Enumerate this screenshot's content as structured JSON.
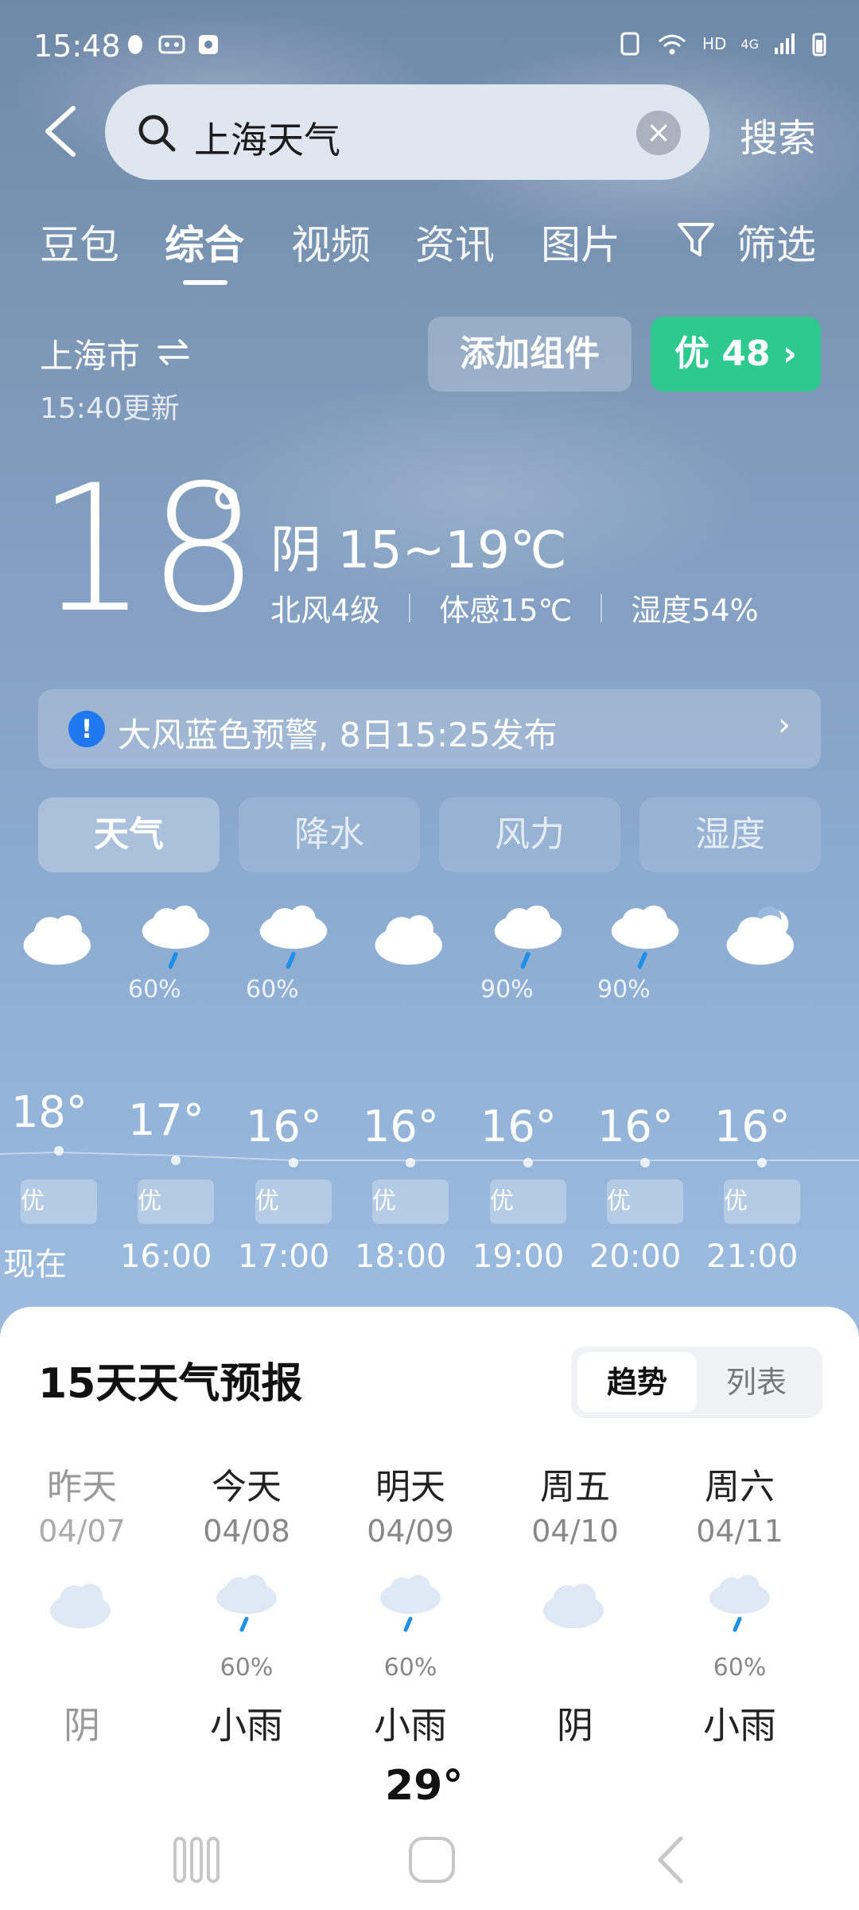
{
  "status_bar": {
    "time": "15:48",
    "network": "HD",
    "signal": "4G"
  },
  "search": {
    "query": "上海天气",
    "submit_label": "搜索"
  },
  "tabs": [
    {
      "label": "豆包"
    },
    {
      "label": "综合"
    },
    {
      "label": "视频"
    },
    {
      "label": "资讯"
    },
    {
      "label": "图片"
    }
  ],
  "filter_label": "筛选",
  "location": {
    "city": "上海市",
    "updated": "15:40更新"
  },
  "add_widget_label": "添加组件",
  "aqi": {
    "label": "优 48 ›",
    "color": "#2ec98f"
  },
  "current": {
    "temp": "18",
    "degree": "°",
    "condition_range": "阴  15~19℃",
    "wind": "北风4级",
    "feels_like": "体感15℃",
    "humidity": "湿度54%"
  },
  "alert": {
    "icon": "!",
    "text": "大风蓝色预警, 8日15:25发布",
    "chevron": "›"
  },
  "subtabs": [
    {
      "label": "天气"
    },
    {
      "label": "降水"
    },
    {
      "label": "风力"
    },
    {
      "label": "湿度"
    }
  ],
  "hourly": [
    {
      "icon": "cloud-icon",
      "precip": "",
      "temp": "18°",
      "aqi": "优",
      "time": "现在"
    },
    {
      "icon": "rain-cloud-icon",
      "precip": "60%",
      "temp": "17°",
      "aqi": "优",
      "time": "16:00"
    },
    {
      "icon": "rain-cloud-icon",
      "precip": "60%",
      "temp": "16°",
      "aqi": "优",
      "time": "17:00"
    },
    {
      "icon": "cloud-icon",
      "precip": "",
      "temp": "16°",
      "aqi": "优",
      "time": "18:00"
    },
    {
      "icon": "rain-cloud-icon",
      "precip": "90%",
      "temp": "16°",
      "aqi": "优",
      "time": "19:00"
    },
    {
      "icon": "rain-cloud-icon",
      "precip": "90%",
      "temp": "16°",
      "aqi": "优",
      "time": "20:00"
    },
    {
      "icon": "moon-cloud-icon",
      "precip": "",
      "temp": "16°",
      "aqi": "优",
      "time": "21:00"
    }
  ],
  "forecast": {
    "title": "15天天气预报",
    "view_trend": "趋势",
    "view_list": "列表",
    "days": [
      {
        "name": "昨天",
        "date": "04/07",
        "icon": "cloud-icon",
        "precip": "",
        "condition": "阴"
      },
      {
        "name": "今天",
        "date": "04/08",
        "icon": "rain-cloud-icon",
        "precip": "60%",
        "condition": "小雨"
      },
      {
        "name": "明天",
        "date": "04/09",
        "icon": "rain-cloud-icon",
        "precip": "60%",
        "condition": "小雨"
      },
      {
        "name": "周五",
        "date": "04/10",
        "icon": "cloud-icon",
        "precip": "",
        "condition": "阴"
      },
      {
        "name": "周六",
        "date": "04/11",
        "icon": "rain-cloud-icon",
        "precip": "60%",
        "condition": "小雨"
      }
    ],
    "high_temp_peek": "29°"
  },
  "colors": {
    "aqi_good": "#2ec98f",
    "alert_blue": "#1f78f0",
    "sky_top": "#6f89a8",
    "sky_bottom": "#a8c6e8"
  }
}
